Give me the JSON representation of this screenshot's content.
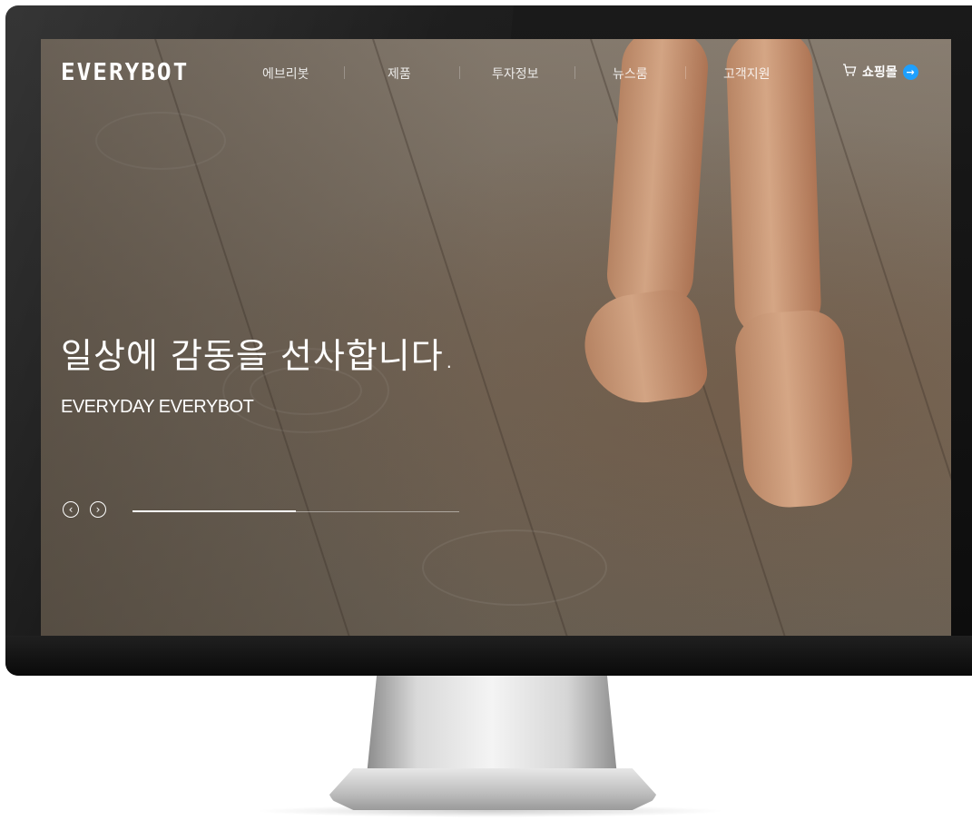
{
  "nav": {
    "logo": "EVERYBOT",
    "items": [
      {
        "label": "에브리봇"
      },
      {
        "label": "제품"
      },
      {
        "label": "투자정보"
      },
      {
        "label": "뉴스룸"
      },
      {
        "label": "고객지원"
      }
    ],
    "shop_label": "쇼핑몰",
    "cart_icon": "cart-icon",
    "arrow_icon": "arrow-right-icon"
  },
  "hero": {
    "headline": "일상에 감동을 선사합니다.",
    "subline": "EVERYDAY EVERYBOT"
  },
  "slider": {
    "prev_glyph": "‹",
    "next_glyph": "›",
    "progress": 0.5
  },
  "colors": {
    "accent": "#1ea0ff"
  }
}
